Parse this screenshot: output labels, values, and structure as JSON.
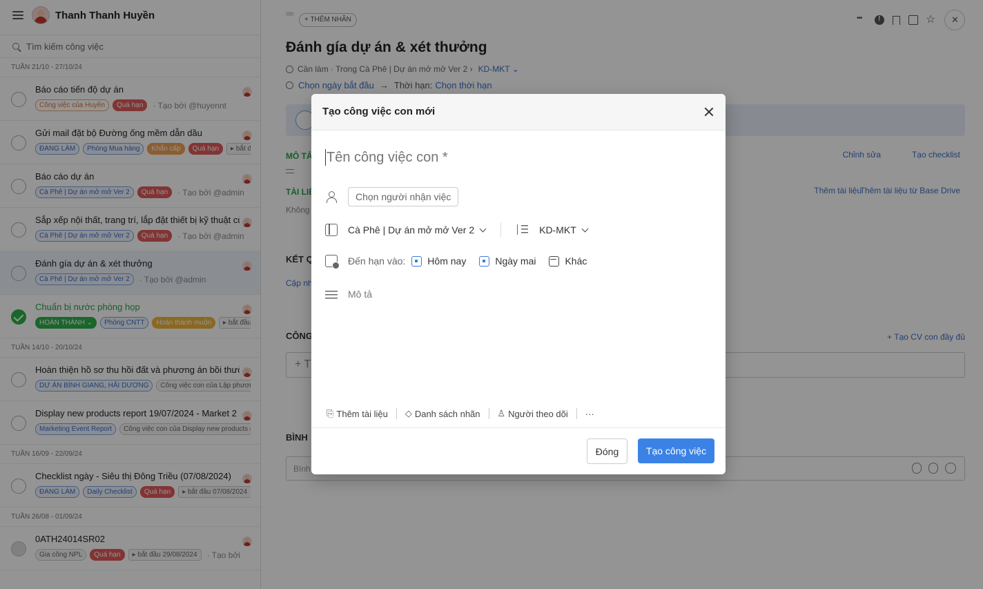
{
  "sidebar": {
    "user_name": "Thanh Thanh Huyền",
    "search_placeholder": "Tìm kiếm công việc",
    "groups": [
      {
        "week": "TUẦN 21/10 - 27/10/24",
        "tasks": [
          {
            "title": "Báo cáo tiến độ dự án",
            "tags": [
              {
                "text": "Công việc của Huyền",
                "style": "orange"
              },
              {
                "text": "Quá hạn",
                "style": "red"
              }
            ],
            "meta": "· Tạo bởi @huyennt"
          },
          {
            "title": "Gửi mail đặt bộ Đường ống mềm dẫn dầu",
            "tags": [
              {
                "text": "ĐANG LÀM",
                "style": "blue"
              },
              {
                "text": "Phòng Mua hàng",
                "style": "blue"
              },
              {
                "text": "Khẩn cấp",
                "style": "orangefill"
              },
              {
                "text": "Quá hạn",
                "style": "red"
              },
              {
                "text": "▸ bắt đầu",
                "style": "arrow"
              }
            ],
            "meta": ""
          },
          {
            "title": "Báo cáo dự án",
            "tags": [
              {
                "text": "Cà Phê | Dự án mở mở Ver 2",
                "style": "blue"
              },
              {
                "text": "Quá hạn",
                "style": "red"
              }
            ],
            "meta": "· Tạo bởi @admin"
          },
          {
            "title": "Sắp xếp nội thất, trang trí, lắp đặt thiết bị kỹ thuật cửa",
            "tags": [
              {
                "text": "Cà Phê | Dự án mở mở Ver 2",
                "style": "blue"
              },
              {
                "text": "Quá hạn",
                "style": "red"
              }
            ],
            "meta": "· Tạo bởi @admin"
          },
          {
            "title": "Đánh gía dự án & xét thưởng",
            "tags": [
              {
                "text": "Cà Phê | Dự án mở mở Ver 2",
                "style": "blue"
              }
            ],
            "meta": "· Tạo bởi @admin",
            "active": true
          },
          {
            "title": "Chuẩn bị nước phòng họp",
            "done": true,
            "tags": [
              {
                "text": "HOÀN THÀNH ⌄",
                "style": "green"
              },
              {
                "text": "Phòng CNTT",
                "style": "blue"
              },
              {
                "text": "Hoàn thành muộn",
                "style": "yellow"
              },
              {
                "text": "▸ bắt đầu",
                "style": "arrow"
              }
            ],
            "meta": ""
          }
        ]
      },
      {
        "week": "TUẦN 14/10 - 20/10/24",
        "tasks": [
          {
            "title": "Hoàn thiện hồ sơ thu hồi đất và phương án bồi thường",
            "tags": [
              {
                "text": "DỰ ÁN BÌNH GIANG, HẢI DƯƠNG",
                "style": "blue"
              },
              {
                "text": "Công việc con của Lập phương án",
                "style": "grey"
              }
            ],
            "meta": ""
          },
          {
            "title": "Display new products report 19/07/2024 - Market 2",
            "tags": [
              {
                "text": "Marketing Event Report",
                "style": "blue"
              },
              {
                "text": "Công việc con của Display new products report",
                "style": "grey"
              }
            ],
            "meta": ""
          }
        ]
      },
      {
        "week": "TUẦN 16/09 - 22/09/24",
        "tasks": [
          {
            "title": "Checklist ngày - Siêu thị Đông Triều (07/08/2024)",
            "tags": [
              {
                "text": "ĐANG LÀM",
                "style": "blue"
              },
              {
                "text": "Daily Checklist",
                "style": "blue"
              },
              {
                "text": "Quá hạn",
                "style": "red"
              },
              {
                "text": "▸ bắt đầu 07/08/2024",
                "style": "arrow"
              }
            ],
            "meta": ""
          }
        ]
      },
      {
        "week": "TUẦN 26/08 - 01/09/24",
        "tasks": [
          {
            "title": "0ATH24014SR02",
            "grey": true,
            "tags": [
              {
                "text": "Gia công NPL",
                "style": "grey"
              },
              {
                "text": "Quá hạn",
                "style": "red"
              },
              {
                "text": "▸ bắt đầu 29/08/2024",
                "style": "arrow"
              }
            ],
            "meta": "· Tạo bởi"
          }
        ]
      }
    ]
  },
  "main": {
    "add_tag_label": "+ THÊM NHÃN",
    "title": "Đánh gía dự án & xét thưởng",
    "status_text": "Cần làm · Trong Cà Phê | Dự án mở mở Ver 2 ›",
    "group": "KD-MKT ⌄",
    "start_date": "Chọn ngày bắt đầu",
    "arrow": "→",
    "deadline_label": "Thời hạn:",
    "deadline_value": "Chọn thời hạn",
    "description_heading": "MÔ TẢ",
    "edit_link": "Chỉnh sửa",
    "checklist_link": "Tạo checklist",
    "documents_heading": "TÀI LIỆ",
    "documents_empty": "Không",
    "add_document_link": "Thêm tài liệu",
    "add_drive_link": "Thêm tài liệu từ Base Drive",
    "result_heading": "KẾT Q",
    "result_update_link": "Cập nh",
    "subtasks_heading": "CÔNG",
    "create_full_subtask_link": "+ Tạo CV con đầy đủ",
    "subtask_input_prefix": "+ T",
    "comments_heading": "BÌNH",
    "comment_placeholder": "Bình"
  },
  "modal": {
    "title": "Tạo công việc con mới",
    "name_placeholder": "Tên công việc con *",
    "assignee_placeholder": "Chọn người nhận việc",
    "project": "Cà Phê | Dự án mở mở Ver 2",
    "group": "KD-MKT",
    "due_label": "Đến hạn vào:",
    "due_options": [
      "Hôm nay",
      "Ngày mai",
      "Khác"
    ],
    "description_placeholder": "Mô tả",
    "tools": [
      "Thêm tài liệu",
      "Danh sách nhãn",
      "Người theo dõi",
      "···"
    ],
    "close_button": "Đóng",
    "create_button": "Tạo công việc"
  },
  "colors": {
    "accent": "#3b82e6",
    "overdue": "#e05a5a",
    "done": "#2db04a",
    "link": "#3a6ec5"
  }
}
